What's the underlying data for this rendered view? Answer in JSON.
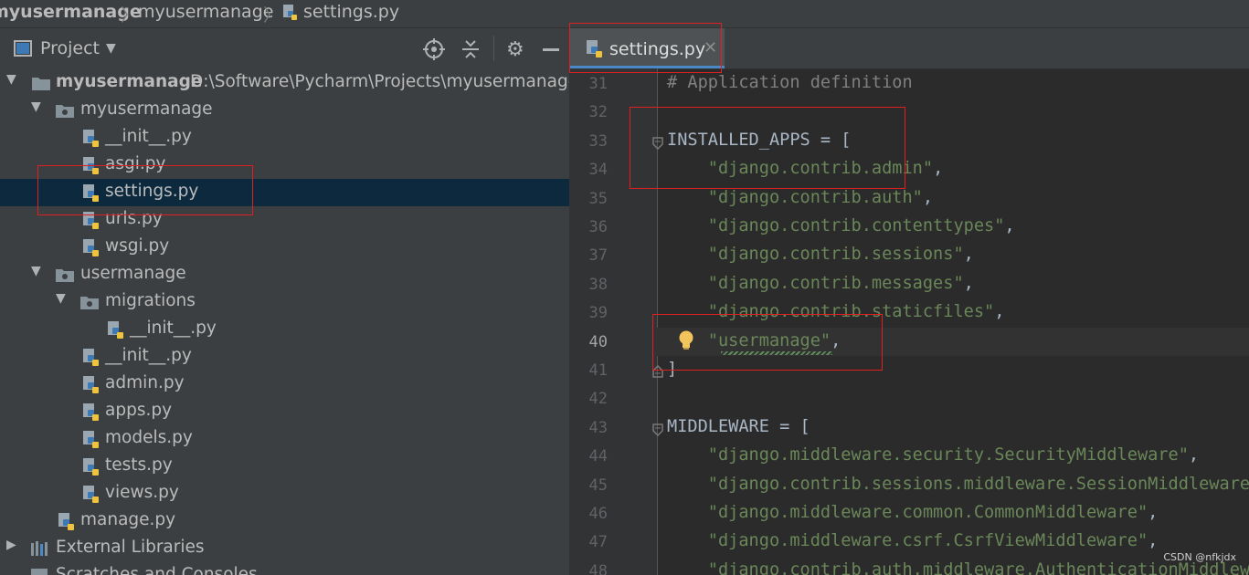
{
  "breadcrumb": {
    "root": "myusermanage",
    "folder": "myusermanage",
    "file": "settings.py"
  },
  "project_panel": {
    "title": "Project",
    "toolbar_icons": [
      "locate-icon",
      "collapse-all-icon",
      "gear-icon",
      "minimize-icon"
    ]
  },
  "tree": {
    "root_name": "myusermanage",
    "root_path": "D:\\Software\\Pycharm\\Projects\\myusermanage",
    "pkg1": "myusermanage",
    "pkg1_files": [
      "__init__.py",
      "asgi.py",
      "settings.py",
      "urls.py",
      "wsgi.py"
    ],
    "pkg2": "usermanage",
    "migrations": "migrations",
    "migrations_files": [
      "__init__.py"
    ],
    "pkg2_files": [
      "__init__.py",
      "admin.py",
      "apps.py",
      "models.py",
      "tests.py",
      "views.py"
    ],
    "manage": "manage.py",
    "ext_libs": "External Libraries",
    "scratches": "Scratches and Consoles"
  },
  "editor": {
    "tab_label": "settings.py",
    "current_line": "40",
    "lines": [
      {
        "n": "31",
        "parts": [
          [
            "cmt",
            "# Application definition"
          ]
        ]
      },
      {
        "n": "32",
        "parts": []
      },
      {
        "n": "33",
        "parts": [
          [
            "",
            "INSTALLED_APPS = ["
          ]
        ]
      },
      {
        "n": "34",
        "parts": [
          [
            "",
            "    "
          ],
          [
            "str",
            "\"django.contrib.admin\""
          ],
          [
            "",
            ","
          ]
        ]
      },
      {
        "n": "35",
        "parts": [
          [
            "",
            "    "
          ],
          [
            "str",
            "\"django.contrib.auth\""
          ],
          [
            "",
            ","
          ]
        ]
      },
      {
        "n": "36",
        "parts": [
          [
            "",
            "    "
          ],
          [
            "str",
            "\"django.contrib.contenttypes\""
          ],
          [
            "",
            ","
          ]
        ]
      },
      {
        "n": "37",
        "parts": [
          [
            "",
            "    "
          ],
          [
            "str",
            "\"django.contrib.sessions\""
          ],
          [
            "",
            ","
          ]
        ]
      },
      {
        "n": "38",
        "parts": [
          [
            "",
            "    "
          ],
          [
            "str",
            "\"django.contrib.messages\""
          ],
          [
            "",
            ","
          ]
        ]
      },
      {
        "n": "39",
        "parts": [
          [
            "",
            "    "
          ],
          [
            "str",
            "\"django.contrib.staticfiles\""
          ],
          [
            "",
            ","
          ]
        ]
      },
      {
        "n": "40",
        "parts": [
          [
            "",
            "    "
          ],
          [
            "str",
            "\"usermanage\""
          ],
          [
            "",
            ","
          ]
        ]
      },
      {
        "n": "41",
        "parts": [
          [
            "",
            "]"
          ]
        ]
      },
      {
        "n": "42",
        "parts": []
      },
      {
        "n": "43",
        "parts": [
          [
            "",
            "MIDDLEWARE = ["
          ]
        ]
      },
      {
        "n": "44",
        "parts": [
          [
            "",
            "    "
          ],
          [
            "str",
            "\"django.middleware.security.SecurityMiddleware\""
          ],
          [
            "",
            ","
          ]
        ]
      },
      {
        "n": "45",
        "parts": [
          [
            "",
            "    "
          ],
          [
            "str",
            "\"django.contrib.sessions.middleware.SessionMiddleware\""
          ],
          [
            "",
            ","
          ]
        ]
      },
      {
        "n": "46",
        "parts": [
          [
            "",
            "    "
          ],
          [
            "str",
            "\"django.middleware.common.CommonMiddleware\""
          ],
          [
            "",
            ","
          ]
        ]
      },
      {
        "n": "47",
        "parts": [
          [
            "",
            "    "
          ],
          [
            "str",
            "\"django.middleware.csrf.CsrfViewMiddleware\""
          ],
          [
            "",
            ","
          ]
        ]
      },
      {
        "n": "48",
        "parts": [
          [
            "",
            "    "
          ],
          [
            "str",
            "\"django.contrib.auth.middleware.AuthenticationMiddleware\""
          ],
          [
            "",
            ","
          ]
        ]
      }
    ]
  },
  "watermark": "CSDN @nfkjdx",
  "colors": {
    "panel_bg": "#3c3f41",
    "editor_bg": "#2b2b2b",
    "selection": "#0d293e",
    "string": "#6a8759",
    "comment": "#808080",
    "annotation_box": "#e02020"
  }
}
